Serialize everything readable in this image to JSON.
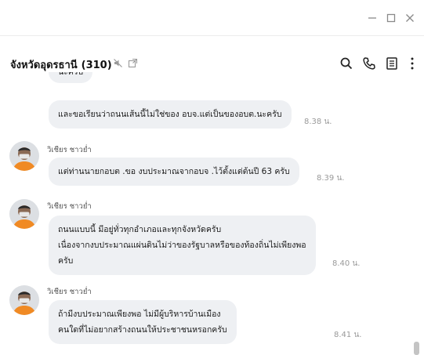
{
  "window": {
    "minimize_icon": "minimize-icon",
    "maximize_icon": "maximize-icon",
    "close_icon": "close-icon"
  },
  "header": {
    "title": "จังหวัดอุดรธานี",
    "member_count": "(310)",
    "icons": [
      "mute-icon",
      "external-link-icon",
      "search-icon",
      "phone-icon",
      "notes-icon",
      "more-icon"
    ]
  },
  "messages": [
    {
      "id": "m0",
      "text_lines": [
        "นะครับ"
      ],
      "time": ""
    },
    {
      "id": "m1",
      "text_lines": [
        "และขอเรียนว่าถนนเส้นนี้ไม่ใช่ของ อบจ.แต่เป็นของอบต.นะครับ"
      ],
      "time": "8.38 น."
    },
    {
      "id": "m2",
      "sender": "วิเชียร ชาวย่ำ",
      "text_lines": [
        "แต่ท่านนายกอบต .ขอ งบประมาณจากอบจ .ไว้ตั้งแต่ต้นปี 63 ครับ"
      ],
      "time": "8.39 น."
    },
    {
      "id": "m3",
      "sender": "วิเชียร ชาวย่ำ",
      "text_lines": [
        "ถนนแบบนี้ มีอยู่ทั่วทุกอำเภอและทุกจังหวัดครับ",
        "เนื่องจากงบประมาณแผ่นดินไม่ว่าของรัฐบาลหรือของท้องถิ่นไม่เพียงพอ",
        "ครับ"
      ],
      "time": "8.40 น."
    },
    {
      "id": "m4",
      "sender": "วิเชียร ชาวย่ำ",
      "text_lines": [
        "ถ้ามีงบประมาณเพียงพอ ไม่มีผู้บริหารบ้านเมือง",
        "คนใดที่ไม่อยากสร้างถนนให้ประชาชนหรอกครับ"
      ],
      "time": "8.41 น."
    }
  ],
  "colors": {
    "bubble": "#eef0f3",
    "header_border": "#ececec",
    "time_text": "#9a9a9a",
    "avatar_shirt": "#f08a24"
  }
}
